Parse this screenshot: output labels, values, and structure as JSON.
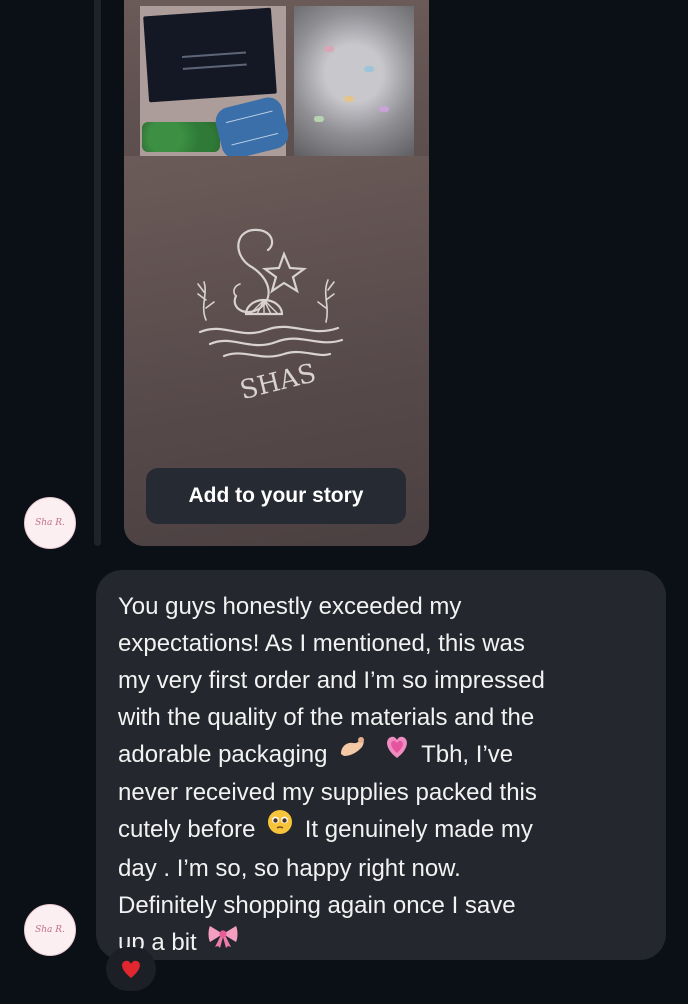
{
  "story": {
    "logo_text": "SHAS",
    "add_to_story_label": "Add to your story"
  },
  "avatar": {
    "text": "Sha R."
  },
  "message": {
    "lines": [
      "You guys honestly exceeded my",
      "expectations! As I mentioned, this was",
      "my very first order and I’m so impressed",
      "with the quality of the materials and the",
      "adorable packaging",
      "Tbh, I’ve",
      "never received my supplies packed this",
      "cutely before",
      "It genuinely made my",
      "day . I’m so, so happy right now.",
      "Definitely shopping again once I save",
      "up a bit"
    ]
  },
  "reaction": {
    "icon": "red-heart-icon",
    "color": "#e0262f"
  },
  "colors": {
    "background": "#0b0f16",
    "bubble": "#24272d",
    "text": "#f2f2f2"
  }
}
